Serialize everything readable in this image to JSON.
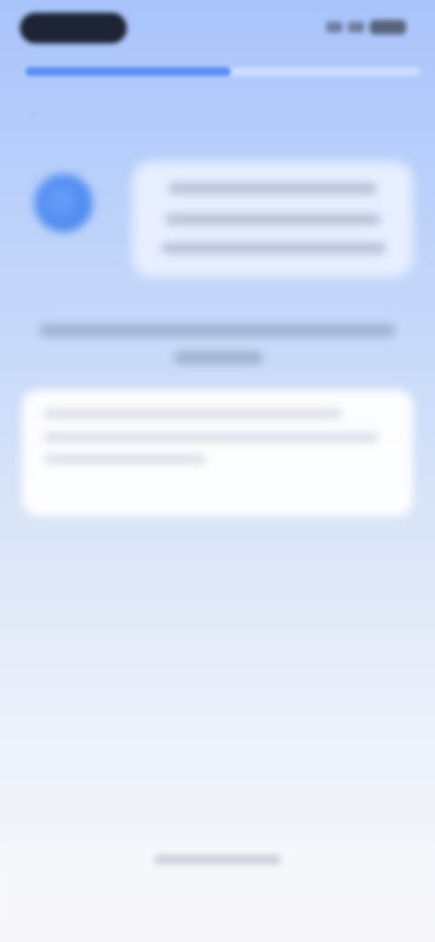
{
  "status_bar": {
    "time_pill": "",
    "icons": [
      "signal-icon",
      "wifi-icon",
      "battery-icon"
    ]
  },
  "progress": {
    "fraction": 0.52
  },
  "chat": {
    "avatar_icon": "assistant-avatar",
    "bubble_text": ""
  },
  "question": {
    "text": ""
  },
  "answer": {
    "text": ""
  },
  "colors": {
    "accent": "#5d8ef2",
    "avatar": "#4a86ef",
    "background_top": "#a9c4fb",
    "background_bottom": "#f5f6fa"
  }
}
